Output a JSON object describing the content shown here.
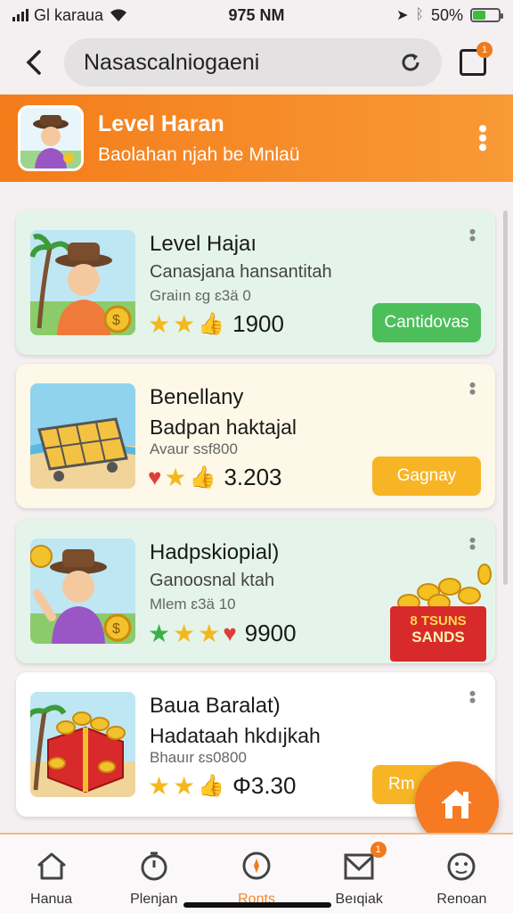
{
  "status_bar": {
    "carrier": "Gl karaua",
    "time": "975 NM",
    "battery": "50%",
    "battery_level": 0.5,
    "icons": [
      "signal-icon",
      "wifi-icon",
      "location-icon",
      "bluetooth-icon",
      "battery-icon"
    ]
  },
  "browser": {
    "url": "Nasascalniogaeni",
    "back_icon": "chevron-left-icon",
    "reload_icon": "reload-icon",
    "tabs_badge": "1"
  },
  "header": {
    "title": "Level Haran",
    "subtitle": "Baolahan njah be Mnlaü"
  },
  "cards": [
    {
      "title": "Level Hajaı",
      "subtitle": "Canasjana hansantitah",
      "meta": "Graiın ɛg ɛ3ä 0",
      "score": "1900",
      "button": "Cantidovas",
      "button_color": "#4cbf5b",
      "icons": [
        "star-icon",
        "star-icon",
        "thumb-up-icon"
      ]
    },
    {
      "title": "Benellany",
      "subtitle": "Badpan haktajal",
      "meta": "Avaur ssf800",
      "score": "3.203",
      "button": "Gagnay",
      "button_color": "#f7b526",
      "icons": [
        "heart-icon",
        "star-icon",
        "thumb-up-icon"
      ]
    },
    {
      "title": "Hadpskiopial)",
      "subtitle": "Ganoosnal ktah",
      "meta": "Mlem ɛ3ä 10",
      "score": "9900",
      "button": "",
      "icons": [
        "green-star-icon",
        "star-icon",
        "star-icon",
        "heart-icon"
      ]
    },
    {
      "title": "Baua Baralat)",
      "subtitle": "Hadataah hkdıjkah",
      "meta": "Bhauır ɛs0800",
      "score": "Φ3.30",
      "button": "Rm",
      "button_color": "#f7b526",
      "icons": [
        "star-icon",
        "star-icon",
        "thumb-up-icon"
      ]
    }
  ],
  "bonus_badge": {
    "line1": "8 TSUNS",
    "line2": "SANDS"
  },
  "bottom_nav": [
    {
      "label": "Hanua",
      "icon": "home-icon",
      "active": false
    },
    {
      "label": "Plenjan",
      "icon": "clock-icon",
      "active": false
    },
    {
      "label": "Ronts",
      "icon": "compass-icon",
      "active": true
    },
    {
      "label": "Beıqiak",
      "icon": "mail-icon",
      "active": false,
      "badge": "1"
    },
    {
      "label": "Renoan",
      "icon": "face-icon",
      "active": false
    }
  ]
}
